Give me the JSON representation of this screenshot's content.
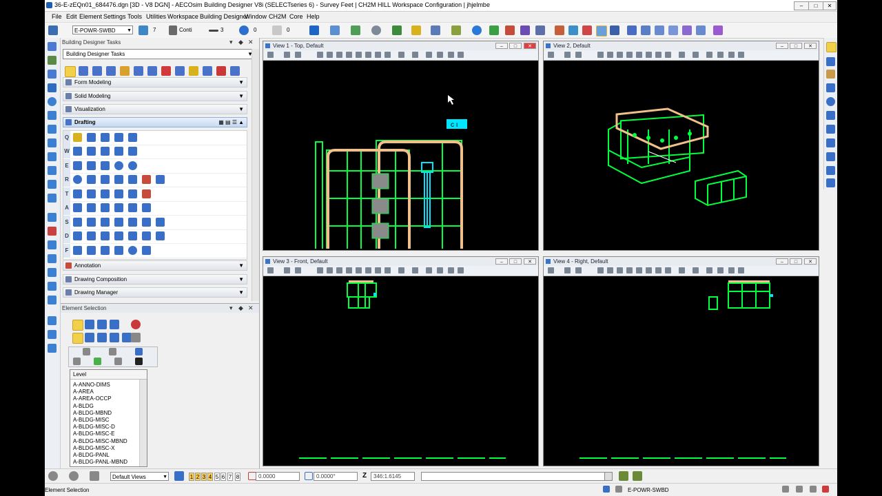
{
  "title": "36-E-zEQn01_684476.dgn [3D - V8 DGN] - AECOsim Building Designer V8i (SELECTseries 6) - Survey Feet  | CH2M HILL Workspace Configuration | jhjelmbe",
  "menu": [
    "File",
    "Edit",
    "Element",
    "Settings",
    "Tools",
    "Utilities",
    "Workspace",
    "Building Designer",
    "Window",
    "CH2M",
    "Core",
    "Help"
  ],
  "toolbar": {
    "level_combo": "E-POWR-SWBD",
    "color_value": "7",
    "style_value": "Conti",
    "weight_value": "3",
    "transparency_value": "0",
    "priority_value": "0"
  },
  "tasks_panel": {
    "header": "Building Designer Tasks",
    "selected_task": "Building Designer Tasks",
    "sections": {
      "form_modeling": "Form Modeling",
      "solid_modeling": "Solid Modeling",
      "visualization": "Visualization",
      "drafting": "Drafting",
      "annotation": "Annotation",
      "drawing_composition": "Drawing Composition",
      "drawing_manager": "Drawing Manager"
    },
    "drafting_rows": [
      "Q",
      "W",
      "E",
      "R",
      "T",
      "A",
      "S",
      "D",
      "F"
    ]
  },
  "element_selection": {
    "header": "Element Selection",
    "level_header": "Level",
    "levels": [
      "A-ANNO-DIMS",
      "A-AREA",
      "A-AREA-OCCP",
      "A-BLDG",
      "A-BLDG-MBND",
      "A-BLDG-MISC",
      "A-BLDG-MISC-D",
      "A-BLDG-MISC-E",
      "A-BLDG-MISC-MBND",
      "A-BLDG-MISC-X",
      "A-BLDG-PANL",
      "A-BLDG-PANL-MBND"
    ]
  },
  "views": {
    "v1": "View 1 - Top, Default",
    "v2": "View 2, Default",
    "v3": "View 3 - Front, Default",
    "v4": "View 4 - Right, Default"
  },
  "status": {
    "view_combo": "Default Views",
    "view_numbers": [
      "1",
      "2",
      "3",
      "4",
      "5",
      "6",
      "7",
      "8"
    ],
    "x_value": "0.0000",
    "y_value": "0.0000°",
    "z_label": "Z",
    "z_value": "346:1.6145",
    "prompt": "Element Selection",
    "active_level": "E-POWR-SWBD"
  },
  "colors": {
    "cad_green": "#00ff3c",
    "cad_tan": "#f0c08a",
    "cad_cyan": "#00e5ff",
    "cad_gray": "#8a8a8a"
  }
}
